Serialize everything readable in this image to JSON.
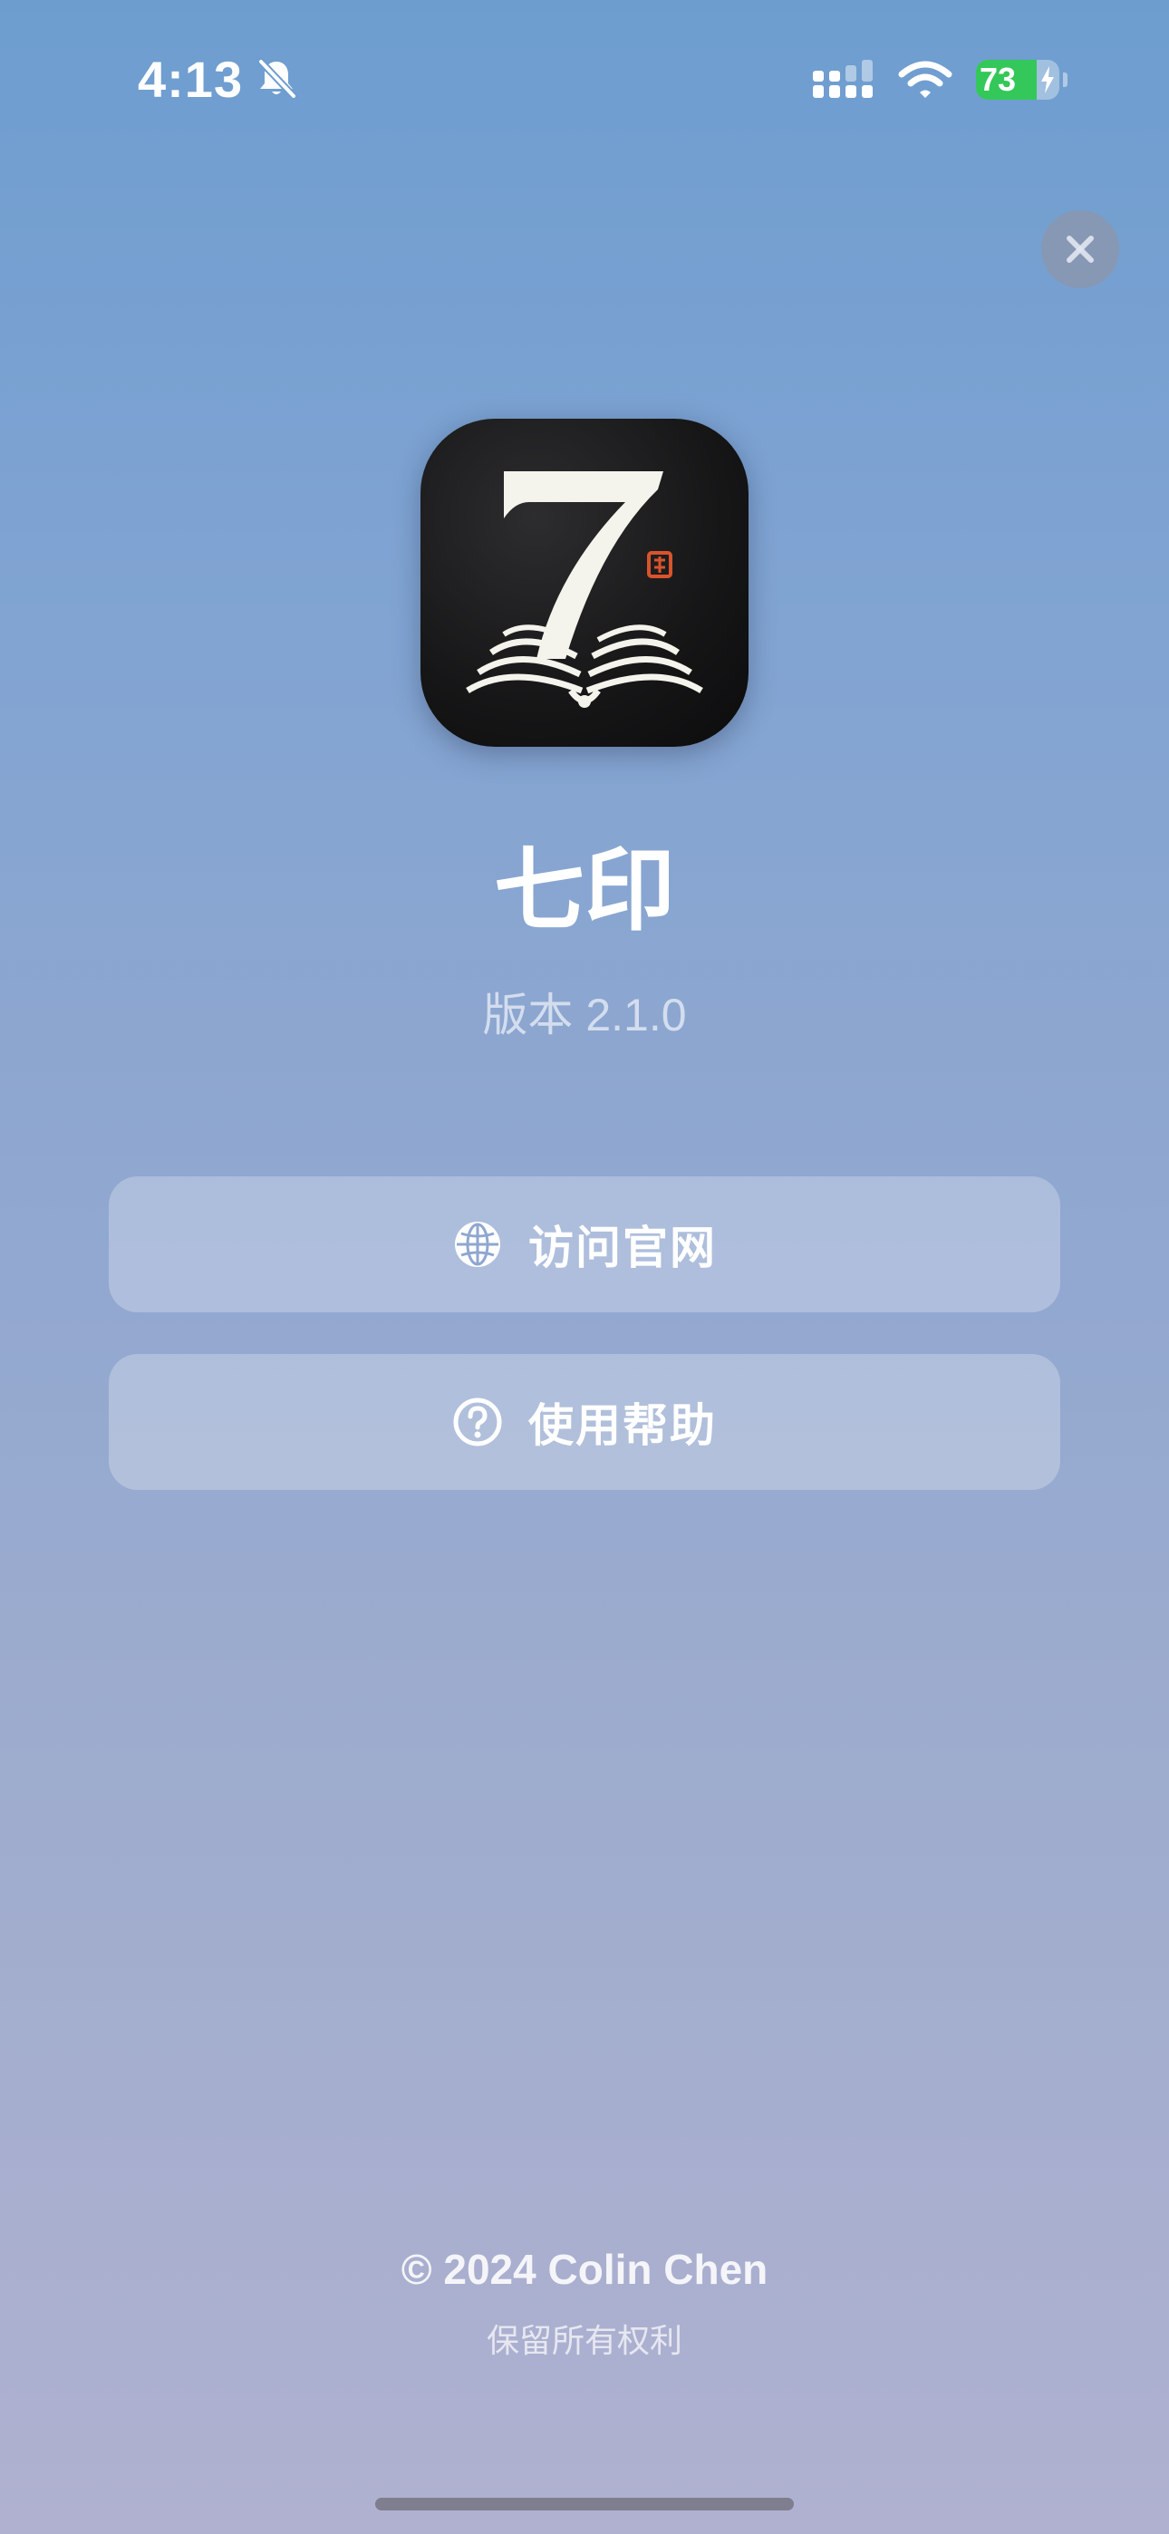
{
  "status_bar": {
    "time": "4:13",
    "battery_level": "73",
    "icons": [
      "bell-slash-icon",
      "cellular-signal-icon",
      "wifi-icon",
      "battery-charging-icon"
    ]
  },
  "close_button": {
    "icon": "close-icon"
  },
  "app": {
    "name": "七印",
    "version": "版本 2.1.0",
    "icon": "app-logo-seven-book"
  },
  "actions": [
    {
      "label": "访问官网",
      "icon": "globe-icon"
    },
    {
      "label": "使用帮助",
      "icon": "question-circle-icon"
    }
  ],
  "footer": {
    "copyright": "© 2024 Colin Chen",
    "rights": "保留所有权利"
  },
  "colors": {
    "background_top": "#6d9dcf",
    "background_bottom": "#b0b1d0",
    "battery_green": "#34c759",
    "logo_seal": "#d9532c"
  }
}
